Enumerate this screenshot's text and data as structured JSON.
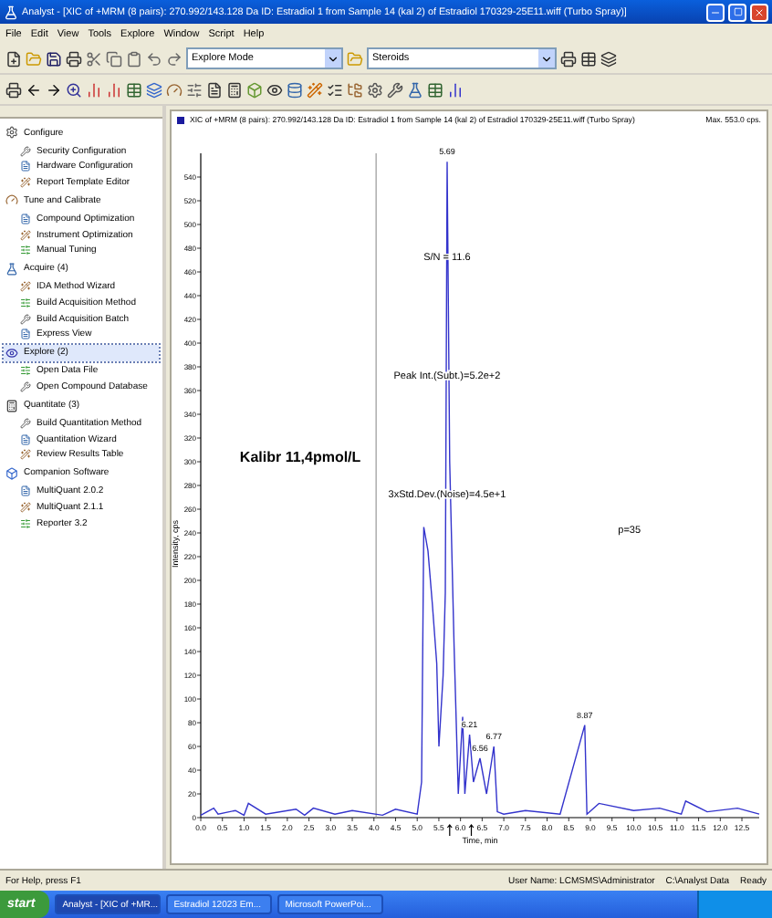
{
  "window": {
    "title": "Analyst - [XIC of +MRM (8 pairs): 270.992/143.128 Da ID: Estradiol 1 from Sample 14 (kal 2) of Estradiol 170329-25E11.wiff (Turbo Spray)]"
  },
  "menu": [
    "File",
    "Edit",
    "View",
    "Tools",
    "Explore",
    "Window",
    "Script",
    "Help"
  ],
  "toolbar": {
    "mode": {
      "value": "Explore Mode"
    },
    "project": {
      "value": "Steroids"
    }
  },
  "sidebar": {
    "sections": [
      {
        "label": "Configure",
        "selected": false,
        "children": [
          {
            "label": "Security Configuration"
          },
          {
            "label": "Hardware Configuration"
          },
          {
            "label": "Report Template Editor"
          }
        ]
      },
      {
        "label": "Tune and Calibrate",
        "selected": false,
        "children": [
          {
            "label": "Compound Optimization"
          },
          {
            "label": "Instrument Optimization"
          },
          {
            "label": "Manual Tuning"
          }
        ]
      },
      {
        "label": "Acquire (4)",
        "selected": false,
        "children": [
          {
            "label": "IDA Method Wizard"
          },
          {
            "label": "Build Acquisition Method"
          },
          {
            "label": "Build Acquisition Batch"
          },
          {
            "label": "Express View"
          }
        ]
      },
      {
        "label": "Explore (2)",
        "selected": true,
        "children": [
          {
            "label": "Open Data File"
          },
          {
            "label": "Open Compound Database"
          }
        ]
      },
      {
        "label": "Quantitate (3)",
        "selected": false,
        "children": [
          {
            "label": "Build Quantitation Method"
          },
          {
            "label": "Quantitation Wizard"
          },
          {
            "label": "Review Results Table"
          }
        ]
      },
      {
        "label": "Companion Software",
        "selected": false,
        "children": [
          {
            "label": "MultiQuant 2.0.2"
          },
          {
            "label": "MultiQuant 2.1.1"
          },
          {
            "label": "Reporter 3.2"
          }
        ]
      }
    ]
  },
  "chart_pane": {
    "header": "XIC of +MRM (8 pairs): 270.992/143.128 Da ID: Estradiol 1 from Sample 14 (kal 2) of Estradiol 170329-25E11.wiff (Turbo Spray)",
    "max": "Max. 553.0 cps.",
    "chart_data": {
      "type": "line",
      "xlabel": "Time, min",
      "ylabel": "Intensity, cps",
      "xlim": [
        0,
        12.9
      ],
      "ylim": [
        0,
        560
      ],
      "x": [
        0,
        0.3,
        0.4,
        0.8,
        1.0,
        1.1,
        1.5,
        2.2,
        2.4,
        2.6,
        3.1,
        3.5,
        4.2,
        4.5,
        5.0,
        5.1,
        5.15,
        5.25,
        5.35,
        5.45,
        5.5,
        5.6,
        5.65,
        5.69,
        5.75,
        5.85,
        5.95,
        6.05,
        6.1,
        6.21,
        6.3,
        6.45,
        6.6,
        6.77,
        6.85,
        7.0,
        7.5,
        8.3,
        8.87,
        8.92,
        9.2,
        10.0,
        10.6,
        11.1,
        11.2,
        11.7,
        12.4,
        12.9
      ],
      "series": [
        {
          "color": "#3333cc",
          "values": [
            2,
            8,
            3,
            6,
            2,
            12,
            3,
            7,
            2,
            8,
            3,
            6,
            2,
            7,
            3,
            30,
            245,
            225,
            180,
            130,
            60,
            120,
            190,
            553,
            300,
            145,
            20,
            85,
            20,
            70,
            30,
            50,
            20,
            60,
            5,
            3,
            6,
            3,
            78,
            3,
            12,
            6,
            8,
            3,
            14,
            5,
            8,
            3
          ]
        }
      ],
      "xticks": [
        {
          "value": 0,
          "label": "0.0"
        },
        {
          "value": 0.5,
          "label": "0.5"
        },
        {
          "value": 1,
          "label": "1.0"
        },
        {
          "value": 1.5,
          "label": "1.5"
        },
        {
          "value": 2,
          "label": "2.0"
        },
        {
          "value": 2.5,
          "label": "2.5"
        },
        {
          "value": 3,
          "label": "3.0"
        },
        {
          "value": 3.5,
          "label": "3.5"
        },
        {
          "value": 4,
          "label": "4.0"
        },
        {
          "value": 4.5,
          "label": "4.5"
        },
        {
          "value": 5,
          "label": "5.0"
        },
        {
          "value": 5.5,
          "label": "5.5"
        },
        {
          "value": 6,
          "label": "6.0"
        },
        {
          "value": 6.5,
          "label": "6.5"
        },
        {
          "value": 7,
          "label": "7.0"
        },
        {
          "value": 7.5,
          "label": "7.5"
        },
        {
          "value": 8,
          "label": "8.0"
        },
        {
          "value": 8.5,
          "label": "8.5"
        },
        {
          "value": 9,
          "label": "9.0"
        },
        {
          "value": 9.5,
          "label": "9.5"
        },
        {
          "value": 10,
          "label": "10.0"
        },
        {
          "value": 10.5,
          "label": "10.5"
        },
        {
          "value": 11,
          "label": "11.0"
        },
        {
          "value": 11.5,
          "label": "11.5"
        },
        {
          "value": 12,
          "label": "12.0"
        },
        {
          "value": 12.5,
          "label": "12.5"
        }
      ],
      "yticks": [
        0,
        20,
        40,
        60,
        80,
        100,
        120,
        140,
        160,
        180,
        200,
        220,
        240,
        260,
        280,
        300,
        320,
        340,
        360,
        380,
        400,
        420,
        440,
        460,
        480,
        500,
        520,
        540
      ],
      "annotations": [
        {
          "text": "5.69",
          "x": 5.69,
          "y": 553
        },
        "S/N = 11.6",
        "Peak Int.(Subt.)=5.2e+2",
        "3xStd.Dev.(Noise)=4.5e+1",
        "Kalibr 11,4pmol/L",
        "p=35",
        {
          "text": "6.21",
          "x": 6.21,
          "y": 70
        },
        {
          "text": "6.56",
          "x": 6.45,
          "y": 50
        },
        {
          "text": "6.77",
          "x": 6.77,
          "y": 60
        },
        {
          "text": "8.87",
          "x": 8.87,
          "y": 78
        }
      ]
    }
  },
  "status_bar": {
    "help": "For Help, press F1",
    "user": "User Name: LCMSMS\\Administrator",
    "path": "C:\\Analyst Data",
    "state": "Ready"
  },
  "taskbar": {
    "start": "start",
    "tasks": [
      {
        "label": "Analyst - [XIC of +MR...",
        "selected": true
      },
      {
        "label": "Estradiol 12023 Em...",
        "selected": false
      },
      {
        "label": "Microsoft PowerPoi...",
        "selected": false
      }
    ]
  }
}
